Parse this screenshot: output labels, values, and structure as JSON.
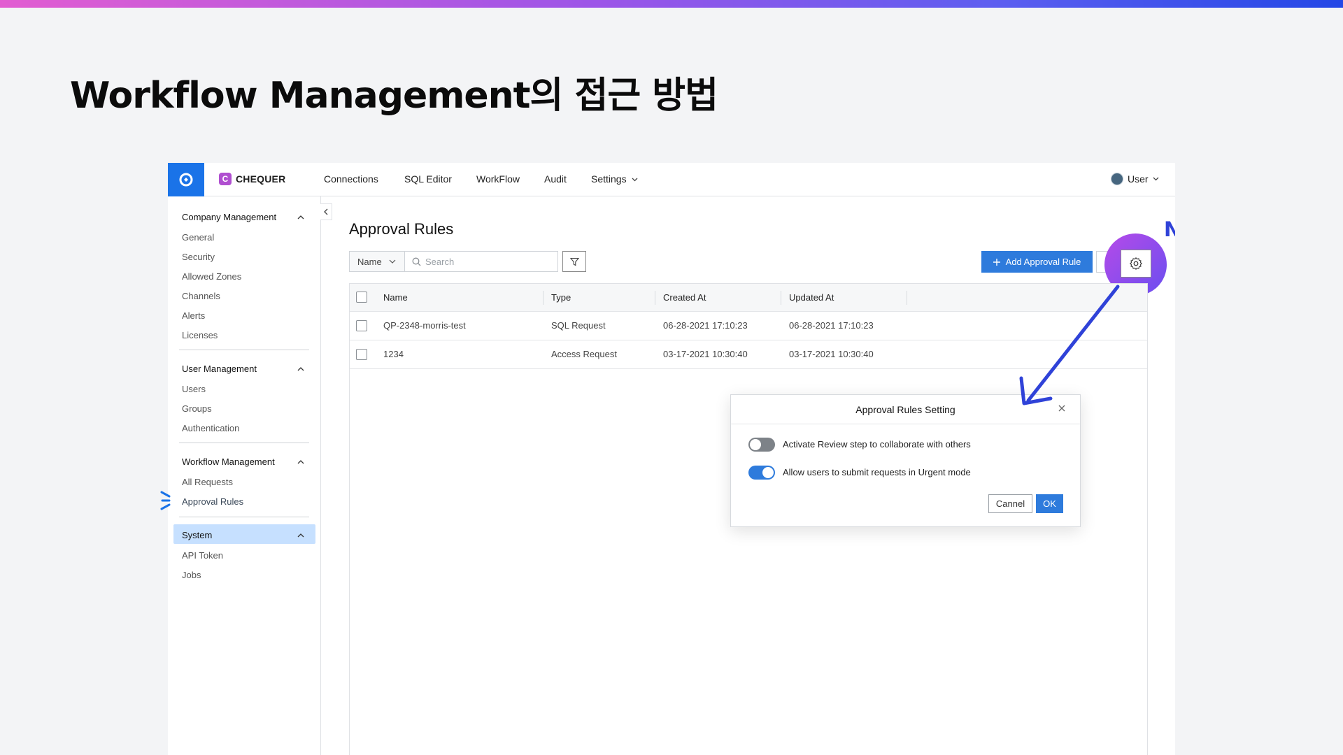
{
  "slide_title": "Workflow Management의 접근 방법",
  "new_badge": "New!",
  "app": {
    "brand": {
      "letter": "C",
      "name": "CHEQUER"
    },
    "nav": [
      {
        "label": "Connections"
      },
      {
        "label": "SQL Editor"
      },
      {
        "label": "WorkFlow"
      },
      {
        "label": "Audit"
      },
      {
        "label": "Settings"
      }
    ],
    "user": "User"
  },
  "sidebar": {
    "sections": [
      {
        "title": "Company Management",
        "items": [
          "General",
          "Security",
          "Allowed Zones",
          "Channels",
          "Alerts",
          "Licenses"
        ]
      },
      {
        "title": "User Management",
        "items": [
          "Users",
          "Groups",
          "Authentication"
        ]
      },
      {
        "title": "Workflow Management",
        "items": [
          "All Requests",
          "Approval Rules"
        ]
      },
      {
        "title": "System",
        "items": [
          "API Token",
          "Jobs"
        ]
      }
    ],
    "active_item": "Approval Rules"
  },
  "main": {
    "title": "Approval Rules",
    "filter_select": "Name",
    "search_placeholder": "Search",
    "add_button": "Add Approval Rule",
    "table": {
      "columns": [
        "Name",
        "Type",
        "Created At",
        "Updated At"
      ],
      "rows": [
        {
          "name": "QP-2348-morris-test",
          "type": "SQL Request",
          "created": "06-28-2021 17:10:23",
          "updated": "06-28-2021 17:10:23"
        },
        {
          "name": "1234",
          "type": "Access Request",
          "created": "03-17-2021 10:30:40",
          "updated": "03-17-2021 10:30:40"
        }
      ]
    }
  },
  "dialog": {
    "title": "Approval Rules Setting",
    "options": [
      {
        "label": "Activate Review step to collaborate with others",
        "enabled": false
      },
      {
        "label": "Allow users to submit requests in Urgent mode",
        "enabled": true
      }
    ],
    "cancel": "Cannel",
    "ok": "OK"
  },
  "colors": {
    "accent": "#2e7bdc",
    "annotation": "#2f42d8",
    "active_bg": "#c6e0ff"
  }
}
